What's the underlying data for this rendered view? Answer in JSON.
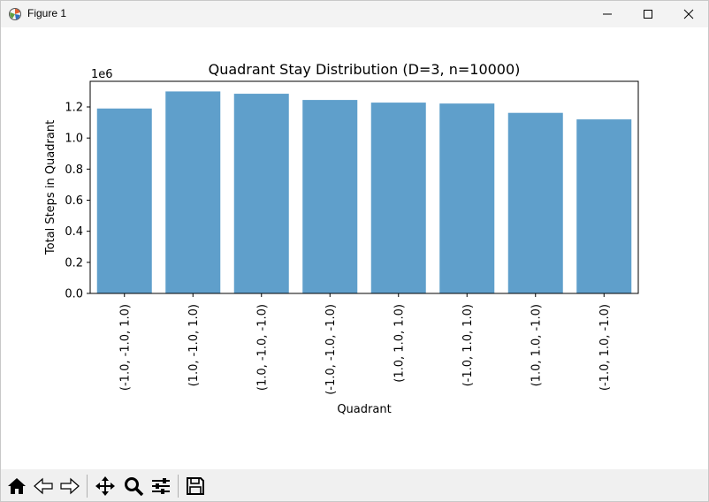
{
  "window": {
    "title": "Figure 1"
  },
  "icons": {
    "app": "matplotlib-figure-icon",
    "minimize": "minimize-icon",
    "maximize": "maximize-icon",
    "close": "close-icon"
  },
  "toolbar": {
    "items": [
      "home-icon",
      "back-arrow-icon",
      "forward-arrow-icon",
      "pan-move-icon",
      "zoom-magnifier-icon",
      "configure-subplots-icon",
      "save-disk-icon"
    ]
  },
  "colors": {
    "bar": "#5f9fcb",
    "axis": "#000000",
    "titlebar": "#f3f3f3",
    "toolbar": "#f0f0f0"
  },
  "chart_data": {
    "type": "bar",
    "title": "Quadrant Stay Distribution (D=3, n=10000)",
    "xlabel": "Quadrant",
    "ylabel": "Total Steps in Quadrant",
    "offset_text": "1e6",
    "categories": [
      "(-1.0, -1.0, 1.0)",
      "(1.0, -1.0, 1.0)",
      "(1.0, -1.0, -1.0)",
      "(-1.0, -1.0, -1.0)",
      "(1.0, 1.0, 1.0)",
      "(-1.0, 1.0, 1.0)",
      "(1.0, 1.0, -1.0)",
      "(-1.0, 1.0, -1.0)"
    ],
    "values": [
      1190000,
      1300000,
      1285000,
      1245000,
      1228000,
      1222000,
      1162000,
      1120000
    ],
    "yticks": [
      0,
      0.2,
      0.4,
      0.6,
      0.8,
      1.0,
      1.2
    ],
    "ytick_labels": [
      "0.0",
      "0.2",
      "0.4",
      "0.6",
      "0.8",
      "1.0",
      "1.2"
    ],
    "tick_scale": 1000000,
    "ylim": [
      0,
      1365000
    ],
    "grid": false,
    "legend": false
  }
}
